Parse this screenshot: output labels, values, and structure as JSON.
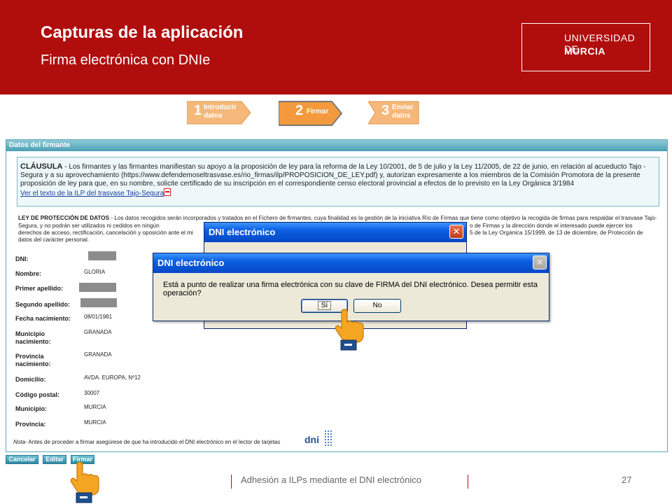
{
  "header": {
    "title": "Capturas de la aplicación",
    "subtitle": "Firma electrónica con DNIe",
    "logo_line1": "UNIVERSIDAD DE",
    "logo_line2": "MURCIA"
  },
  "steps": [
    {
      "num": "1",
      "label1": "Introducir",
      "label2": "datos",
      "active": false
    },
    {
      "num": "2",
      "label1": "Firmar",
      "label2": "",
      "active": true
    },
    {
      "num": "3",
      "label1": "Enviar",
      "label2": "datos",
      "active": false
    }
  ],
  "form": {
    "section_title": "Datos del firmante",
    "clausula_title": "CLÁUSULA",
    "clausula_text": " - Los firmantes y las firmantes manifiestan su apoyo a la proposición de ley para la reforma de la Ley 10/2001, de 5 de julio y la Ley 11/2005, de 22 de junio, en relación al acueducto Tajo -Segura y a su aprovechamiento (https://www.defendemoseltrasvase.es/rio_firmas/ilp/PROPOSICION_DE_LEY.pdf) y, autorizan expresamente a los miembros de la Comisión Promotora de la presente proposición de ley para que, en su nombre, solicite certificado de su inscripción en el correspondiente censo electoral provincial a efectos de lo previsto en la Ley Orgánica 3/1984",
    "clausula_link": "Ver el texto de la ILP del trasvase Tajo-Segura",
    "ley_title": "LEY DE PROTECCIÓN DE DATOS",
    "ley_text_left": " - Los datos recogidos serán incorporados y tratados en el Fichero de firmantes, cuya finalidad es la gestión de la iniciativa Río de Firmas que tiene como objetivo la recogida de firmas para respaldar el trasvase Tajo-Segura, y no podrán ser utilizados ni cedidos en ningún",
    "ley_text_right1": "o de Firmas y la dirección donde el interesado puede ejercer los",
    "ley_text_right2": "5 de la Ley Orgánica 15/1999, de 13 de diciembre, de Protección de",
    "ley_line3": "derechos de acceso, rectificación, cancelación y oposición ante el mi",
    "ley_line4": "datos del carácter personal.",
    "fields": [
      {
        "label": "DNI:",
        "value": ""
      },
      {
        "label": "Nombre:",
        "value": "GLORIA"
      },
      {
        "label": "Primer apellido:",
        "value": ""
      },
      {
        "label": "Segundo apellido:",
        "value": ""
      },
      {
        "label": "Fecha nacimiento:",
        "value": "08/01/1981"
      },
      {
        "label": "Municipio nacimiento:",
        "value": "GRANADA"
      },
      {
        "label": "Provincia nacimiento:",
        "value": "GRANADA"
      },
      {
        "label": "Domicilio:",
        "value": "AVDA. EUROPA, Nº12"
      },
      {
        "label": "Código postal:",
        "value": "30007"
      },
      {
        "label": "Municipio:",
        "value": "MURCIA"
      },
      {
        "label": "Provincia:",
        "value": "MURCIA"
      }
    ],
    "nota_label": "Nota",
    "nota_text": "- Antes de proceder a firmar asegúrese de que ha introducido el DNI electrónico en el lector de tarjetas",
    "dni_logo_text": "dni"
  },
  "buttons": {
    "cancel": "Cancelar",
    "edit": "Editar",
    "sign": "Firmar"
  },
  "dialog_back": {
    "title": "DNI electrónico",
    "close": "✕"
  },
  "dialog_front": {
    "title": "DNI electrónico",
    "message": "Está a punto de realizar una firma electrónica con su clave de FIRMA del DNI electrónico. Desea permitir esta operación?",
    "yes": "Sí",
    "no": "No",
    "close": "✕"
  },
  "footer": {
    "text": "Adhesión a ILPs mediante el DNI electrónico",
    "page": "27"
  },
  "colors": {
    "header_red": "#b00d0d",
    "step_orange": "#f2a55a",
    "panel_teal": "#49a0b5",
    "xp_blue": "#0a5ee0"
  }
}
